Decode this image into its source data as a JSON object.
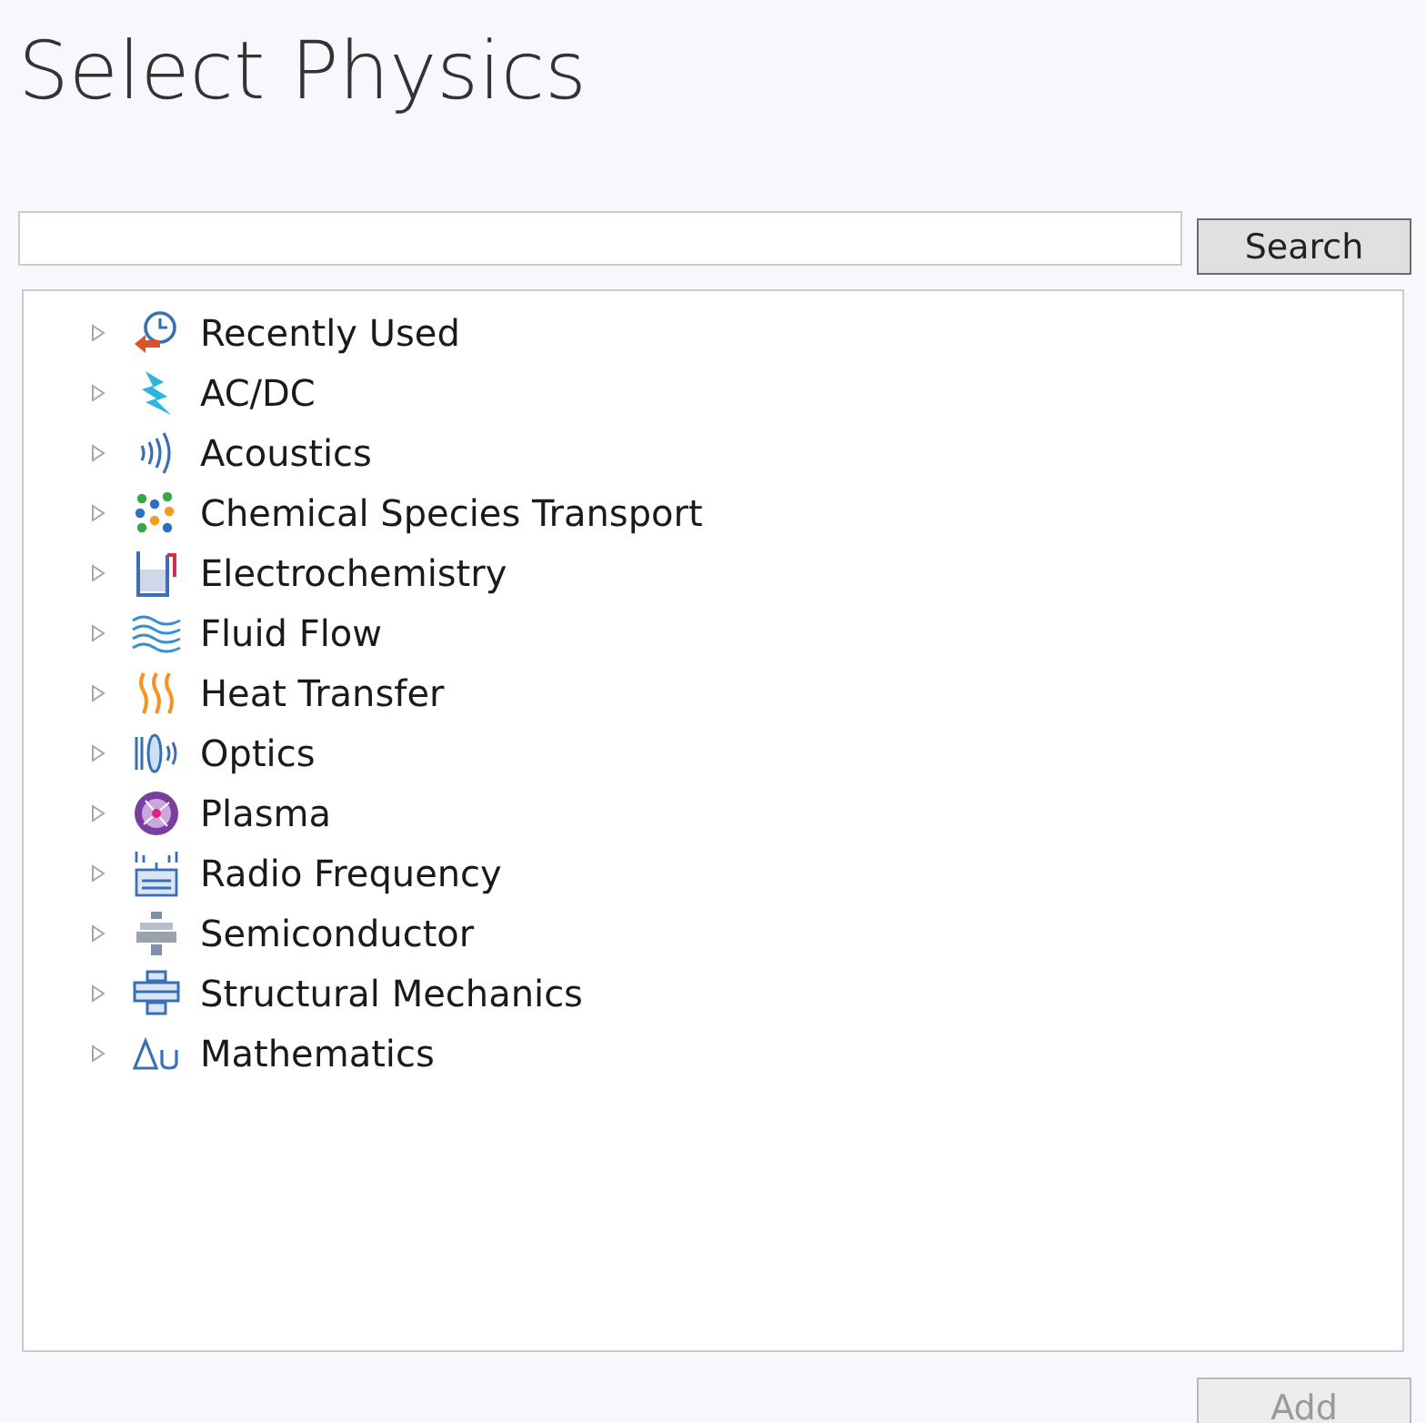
{
  "title": "Select Physics",
  "search": {
    "button": "Search"
  },
  "tree": [
    {
      "label": "Recently Used",
      "expanded": false
    },
    {
      "label": "AC/DC",
      "expanded": false
    },
    {
      "label": "Acoustics",
      "expanded": false
    },
    {
      "label": "Chemical Species Transport",
      "expanded": false
    },
    {
      "label": "Electrochemistry",
      "expanded": false
    },
    {
      "label": "Fluid Flow",
      "expanded": false
    },
    {
      "label": "Heat Transfer",
      "expanded": false
    },
    {
      "label": "Optics",
      "expanded": false
    },
    {
      "label": "Plasma",
      "expanded": false
    },
    {
      "label": "Radio Frequency",
      "expanded": false
    },
    {
      "label": "Semiconductor",
      "expanded": false
    },
    {
      "label": "Structural Mechanics",
      "expanded": false
    },
    {
      "label": "Mathematics",
      "expanded": false
    }
  ],
  "add_button": {
    "label": "Add",
    "disabled": true
  }
}
